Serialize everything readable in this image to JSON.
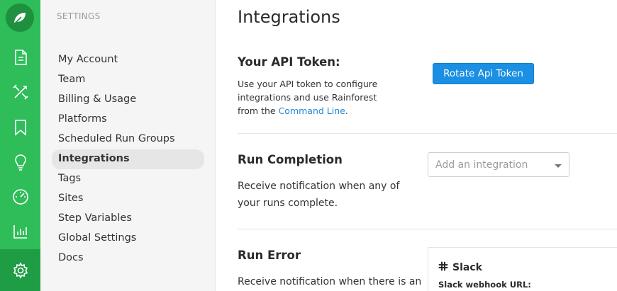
{
  "rail": {
    "items": [
      {
        "icon": "document-icon"
      },
      {
        "icon": "tools-icon"
      },
      {
        "icon": "bookmark-icon"
      },
      {
        "icon": "lightbulb-icon"
      },
      {
        "icon": "dashboard-gauge-icon"
      },
      {
        "icon": "bar-chart-icon"
      },
      {
        "icon": "gear-icon",
        "active": true
      }
    ],
    "colors": {
      "background": "#2ebd59",
      "logo": "#1f8f40",
      "active": "#1f9d45"
    }
  },
  "settings": {
    "heading": "SETTINGS",
    "items": [
      {
        "label": "My Account"
      },
      {
        "label": "Team"
      },
      {
        "label": "Billing & Usage"
      },
      {
        "label": "Platforms"
      },
      {
        "label": "Scheduled Run Groups"
      },
      {
        "label": "Integrations",
        "active": true
      },
      {
        "label": "Tags"
      },
      {
        "label": "Sites"
      },
      {
        "label": "Step Variables"
      },
      {
        "label": "Global Settings"
      },
      {
        "label": "Docs"
      }
    ]
  },
  "main": {
    "title": "Integrations",
    "api_token": {
      "title": "Your API Token:",
      "desc_before": "Use your API token to configure integrations and use Rainforest from the ",
      "link": "Command Line",
      "desc_after": ".",
      "button": "Rotate Api Token"
    },
    "run_completion": {
      "title": "Run Completion",
      "desc": "Receive notification when any of your runs complete.",
      "select_placeholder": "Add an integration"
    },
    "run_error": {
      "title": "Run Error",
      "desc": "Receive notification when there is an",
      "card": {
        "title": "Slack",
        "field_label": "Slack webhook URL:"
      }
    }
  },
  "colors": {
    "accent": "#1a8fe3",
    "link": "#1e88d6"
  }
}
